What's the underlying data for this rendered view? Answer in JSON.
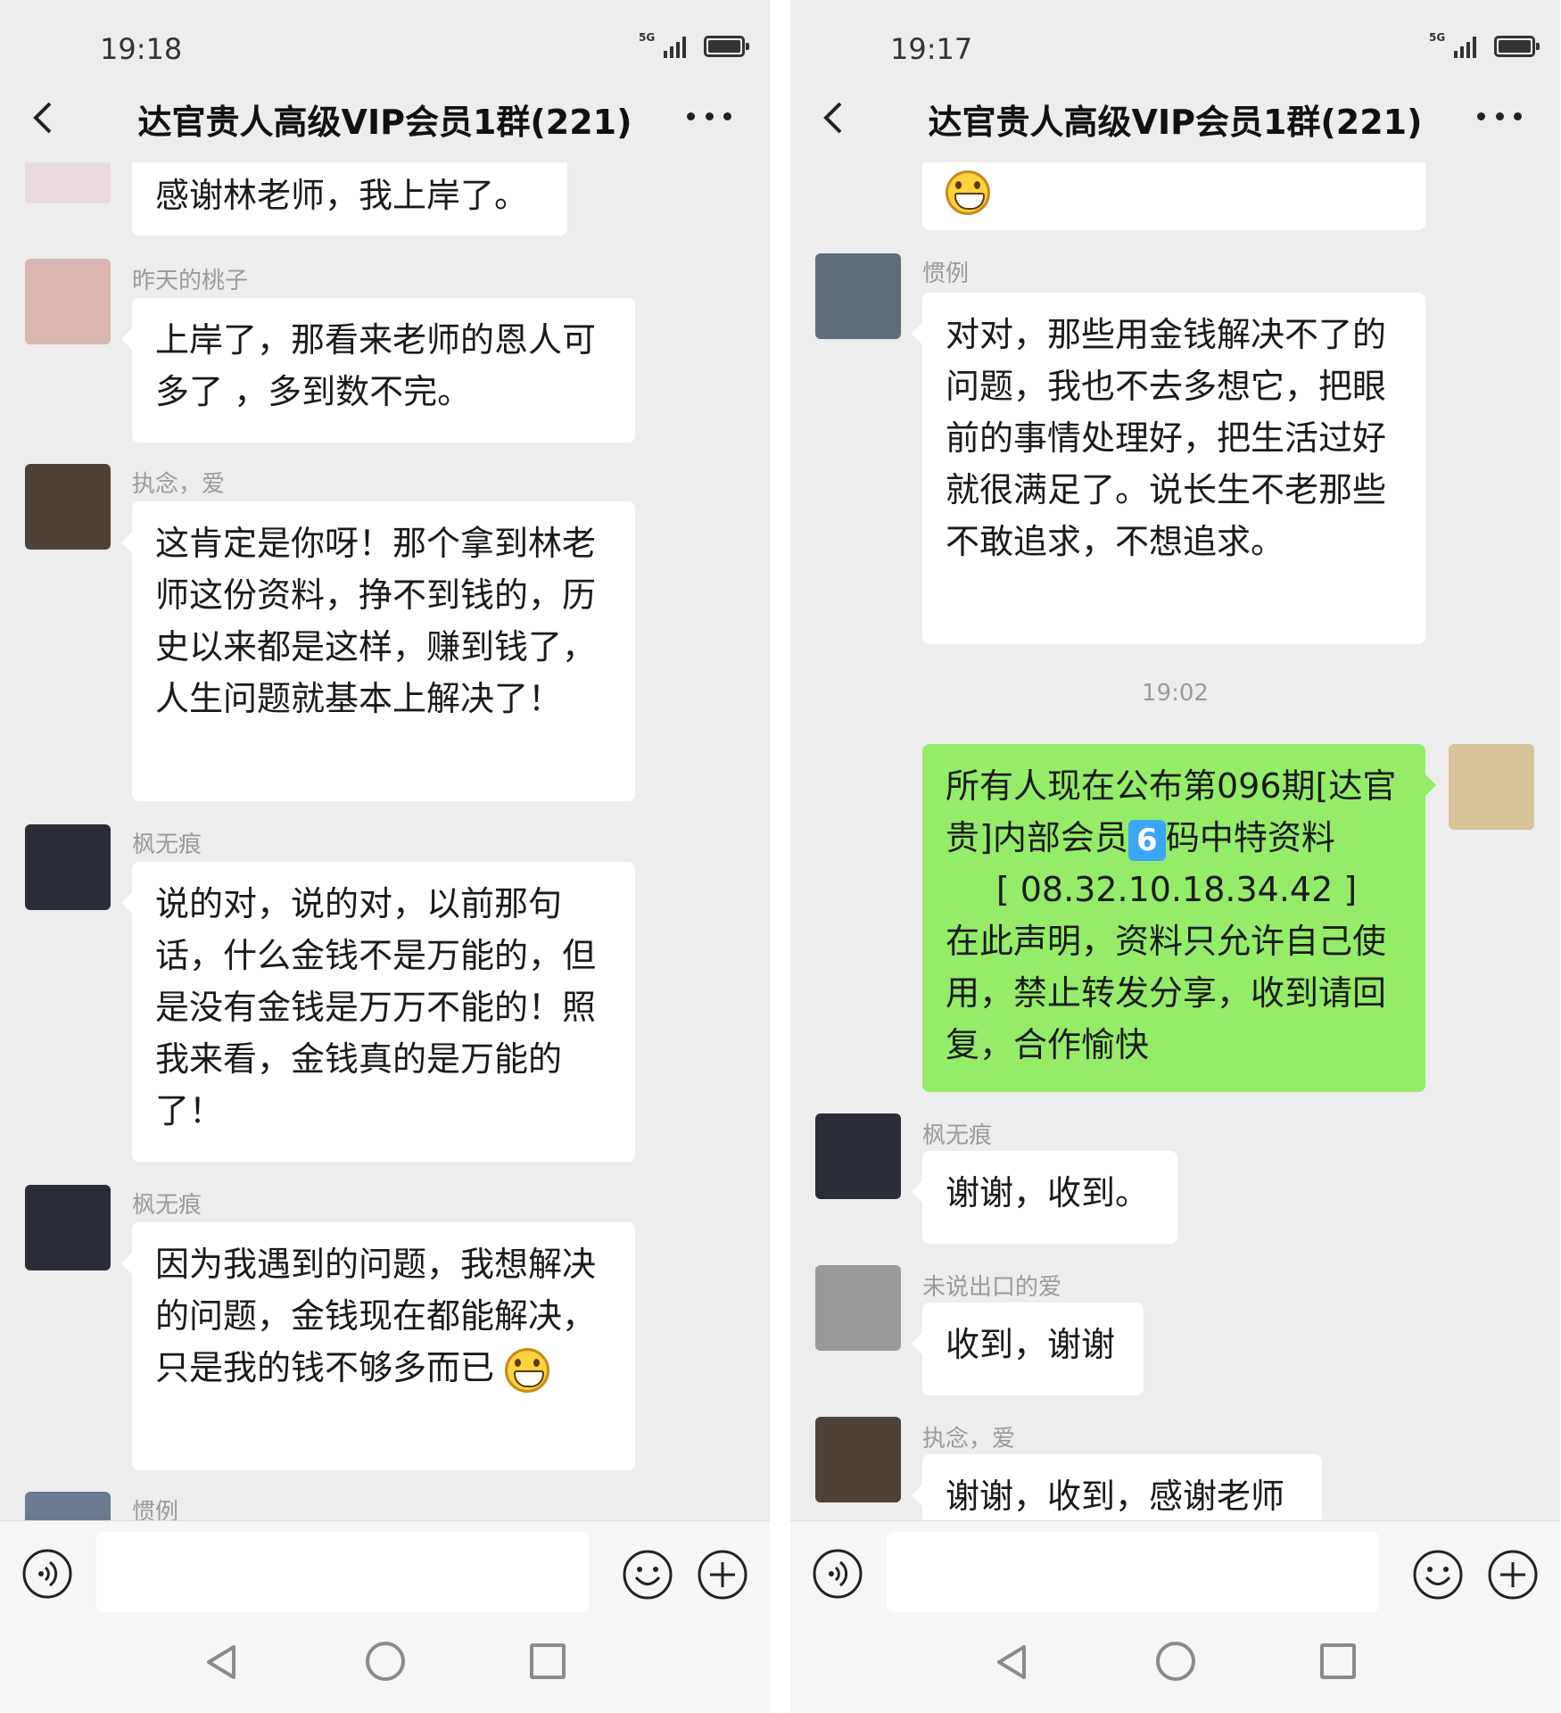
{
  "left": {
    "status": {
      "time": "19:18",
      "network": "5G"
    },
    "header": {
      "title": "达官贵人高级VIP会员1群(221)"
    },
    "messages": {
      "m1_text": "感谢林老师，我上岸了。",
      "m2_sender": "昨天的桃子",
      "m2_text": "上岸了，那看来老师的恩人可多了 ，多到数不完。",
      "m3_sender": "执念，爱",
      "m3_text": "这肯定是你呀！那个拿到林老师这份资料，挣不到钱的，历史以来都是这样，赚到钱了，人生问题就基本上解决了！",
      "m4_sender": "枫无痕",
      "m4_text": "说的对，说的对，以前那句话，什么金钱不是万能的，但是没有金钱是万万不能的！照我来看，金钱真的是万能的了！",
      "m5_sender": "枫无痕",
      "m5_text": "因为我遇到的问题，我想解决的问题，金钱现在都能解决，只是我的钱不够多而已",
      "m6_sender": "惯例"
    },
    "input": {
      "placeholder": ""
    }
  },
  "right": {
    "status": {
      "time": "19:17",
      "network": "5G"
    },
    "header": {
      "title": "达官贵人高级VIP会员1群(221)"
    },
    "messages": {
      "m2_sender": "惯例",
      "m2_text": "对对，那些用金钱解决不了的问题，我也不去多想它，把眼前的事情处理好，把生活过好就很满足了。说长生不老那些不敢追求，不想追求。",
      "timestamp": "19:02",
      "m3_line1": "所有人现在公布第096期[达官贵]内部会员",
      "m3_badge": "6",
      "m3_line2": "码中特资料",
      "m3_numbers": "[ 08.32.10.18.34.42 ]",
      "m3_line3": "在此声明，资料只允许自己使用，禁止转发分享，收到请回复，合作愉快",
      "m4_sender": "枫无痕",
      "m4_text": "谢谢，收到。",
      "m5_sender": "未说出口的爱",
      "m5_text": "收到，谢谢",
      "m6_sender": "执念，爱",
      "m6_text": "谢谢，收到，感谢老师"
    },
    "input": {
      "placeholder": ""
    }
  },
  "colors": {
    "chat_bg": "#ededed",
    "incoming_bubble": "#ffffff",
    "outgoing_bubble": "#95ec69",
    "meta_text": "#9a9a9a"
  }
}
